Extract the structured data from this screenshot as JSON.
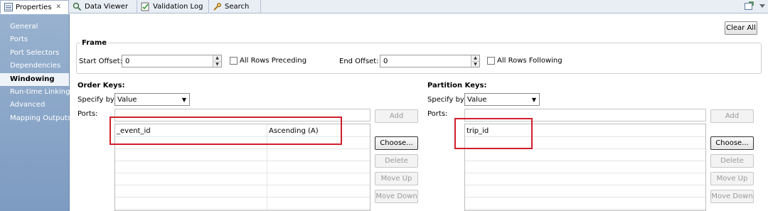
{
  "tabs": [
    {
      "label": "Properties",
      "icon": "properties-icon",
      "active": true
    },
    {
      "label": "Data Viewer",
      "icon": "data-viewer-icon"
    },
    {
      "label": "Validation Log",
      "icon": "validation-log-icon"
    },
    {
      "label": "Search",
      "icon": "search-icon"
    }
  ],
  "close_glyph": "✕",
  "sidebar": {
    "items": [
      {
        "label": "General"
      },
      {
        "label": "Ports"
      },
      {
        "label": "Port Selectors"
      },
      {
        "label": "Dependencies"
      },
      {
        "label": "Windowing",
        "selected": true
      },
      {
        "label": "Run-time Linking"
      },
      {
        "label": "Advanced"
      },
      {
        "label": "Mapping Outputs"
      }
    ]
  },
  "main": {
    "clear_all": "Clear All",
    "frame": {
      "title": "Frame",
      "start_offset_label": "Start Offset:",
      "start_offset_value": "0",
      "all_rows_preceding": "All Rows Preceding",
      "end_offset_label": "End Offset:",
      "end_offset_value": "0",
      "all_rows_following": "All Rows Following"
    },
    "order_keys": {
      "title": "Order Keys:",
      "specify_by_label": "Specify by:",
      "specify_by_value": "Value",
      "ports_label": "Ports:",
      "rows": [
        {
          "port": "_event_id",
          "order": "Ascending (A)"
        }
      ],
      "buttons": {
        "add": "Add",
        "choose": "Choose...",
        "delete": "Delete",
        "move_up": "Move Up",
        "move_down": "Move Down"
      }
    },
    "partition_keys": {
      "title": "Partition Keys:",
      "specify_by_label": "Specify by:",
      "specify_by_value": "Value",
      "ports_label": "Ports:",
      "rows": [
        {
          "port": "trip_id"
        }
      ],
      "buttons": {
        "add": "Add",
        "choose": "Choose...",
        "delete": "Delete",
        "move_up": "Move Up",
        "move_down": "Move Down"
      }
    }
  },
  "colors": {
    "highlight_box": "#d11f2a",
    "sidebar": "#8aa6c9"
  }
}
